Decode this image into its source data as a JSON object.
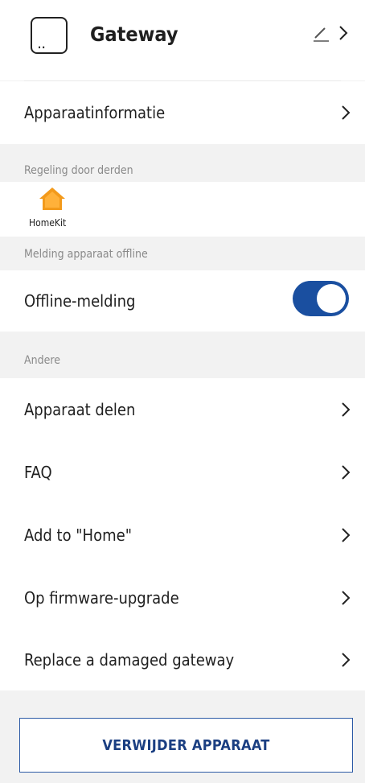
{
  "header": {
    "title": "Gateway",
    "device_icon_text": ".."
  },
  "rows": {
    "device_info": "Apparaatinformatie",
    "offline_notification": "Offline-melding",
    "share_device": "Apparaat delen",
    "faq": "FAQ",
    "add_to_home": "Add to \"Home\"",
    "firmware_upgrade": "Op firmware-upgrade",
    "replace_gateway": "Replace a damaged gateway"
  },
  "sections": {
    "third_party": "Regeling door derden",
    "offline": "Melding apparaat offline",
    "other": "Andere"
  },
  "homekit": {
    "label": "HomeKit",
    "icon": "home-icon"
  },
  "toggle": {
    "offline_enabled": true
  },
  "delete_button": "VERWIJDER APPARAAT",
  "colors": {
    "accent": "#1a4fa0",
    "button_text": "#1b3f82",
    "background": "#f2f2f2",
    "homekit_orange": "#f39a1b"
  }
}
